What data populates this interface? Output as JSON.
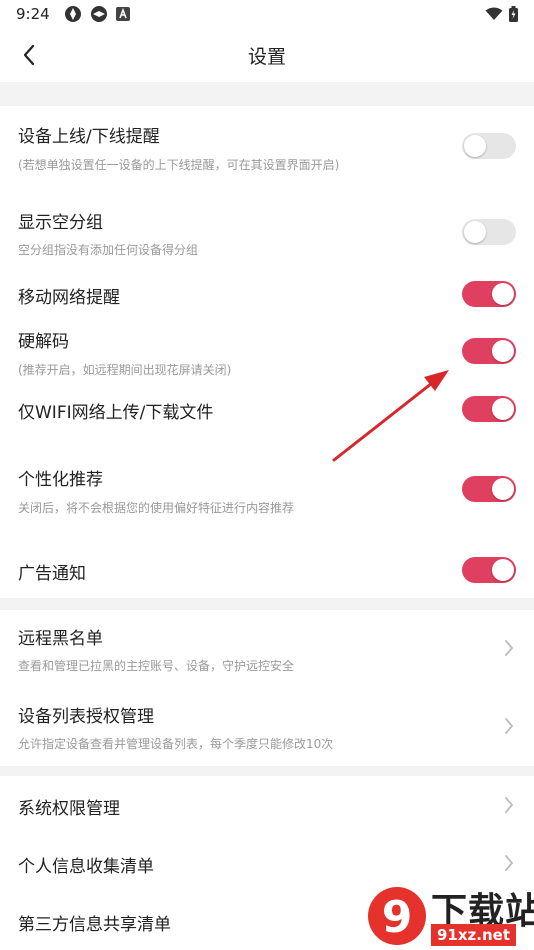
{
  "status_bar": {
    "time": "9:24",
    "icons_left": [
      "aperture-icon",
      "aperture-icon",
      "a-notification-icon"
    ],
    "icons_right": [
      "wifi-icon",
      "battery-charging-icon"
    ]
  },
  "nav": {
    "title": "设置",
    "back_icon": "chevron-left-icon"
  },
  "settings": {
    "device_online": {
      "title": "设备上线/下线提醒",
      "subtitle": "(若想单独设置任一设备的上下线提醒，可在其设置界面开启)",
      "enabled": false
    },
    "show_empty_group": {
      "title": "显示空分组",
      "subtitle": "空分组指没有添加任何设备得分组",
      "enabled": false
    },
    "mobile_network_alert": {
      "title": "移动网络提醒",
      "enabled": true
    },
    "hardware_decoding": {
      "title": "硬解码",
      "subtitle": "(推荐开启，如远程期间出现花屏请关闭)",
      "enabled": true
    },
    "wifi_only_transfer": {
      "title": "仅WIFI网络上传/下载文件",
      "enabled": true
    },
    "personalized_recommend": {
      "title": "个性化推荐",
      "subtitle": "关闭后，将不会根据您的使用偏好特征进行内容推荐",
      "enabled": true
    },
    "ad_notification": {
      "title": "广告通知",
      "enabled": true
    }
  },
  "links": {
    "remote_blacklist": {
      "title": "远程黑名单",
      "subtitle": "查看和管理已拉黑的主控账号、设备，守护远控安全"
    },
    "device_list_auth": {
      "title": "设备列表授权管理",
      "subtitle": "允许指定设备查看并管理设备列表，每个季度只能修改10次"
    },
    "system_permission": {
      "title": "系统权限管理"
    },
    "personal_info_list": {
      "title": "个人信息收集清单"
    },
    "third_party_share": {
      "title": "第三方信息共享清单"
    }
  },
  "watermark": {
    "brand_text": "下载站",
    "domain_text": "91xz.net",
    "logo_glyph": "9"
  },
  "colors": {
    "accent": "#e0405f",
    "toggle_off": "#e6e6e6",
    "annotation_arrow": "#d9262b",
    "divider_band": "#f3f3f3",
    "subtitle_text": "#9a9a9a"
  }
}
